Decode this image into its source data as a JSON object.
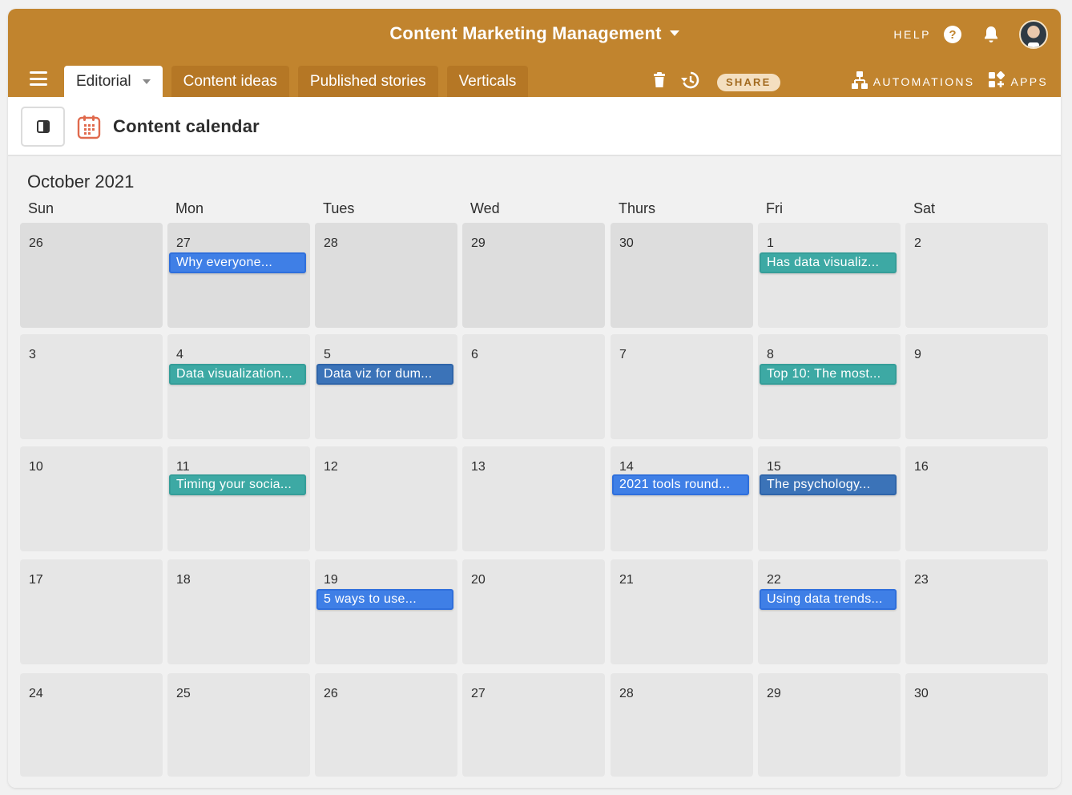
{
  "header": {
    "base_title": "Content Marketing Management",
    "help_label": "HELP",
    "help_glyph": "?",
    "icons": [
      "chevron-down-icon",
      "help-icon",
      "bell-icon",
      "avatar"
    ]
  },
  "tabs": [
    {
      "label": "Editorial",
      "active": true
    },
    {
      "label": "Content ideas",
      "active": false
    },
    {
      "label": "Published stories",
      "active": false
    },
    {
      "label": "Verticals",
      "active": false
    }
  ],
  "toolbar": {
    "share_label": "SHARE",
    "automations_label": "AUTOMATIONS",
    "apps_label": "APPS",
    "icons": [
      "trash-icon",
      "history-icon",
      "automations-icon",
      "apps-icon"
    ]
  },
  "view": {
    "title": "Content calendar",
    "icon": "calendar-icon"
  },
  "calendar": {
    "month_label": "October 2021",
    "weekdays": [
      "Sun",
      "Mon",
      "Tues",
      "Wed",
      "Thurs",
      "Fri",
      "Sat"
    ],
    "weeks": [
      [
        {
          "day": "26",
          "outside_month": true
        },
        {
          "day": "27",
          "outside_month": true,
          "event": {
            "title": "Why everyone...",
            "color": "blue"
          }
        },
        {
          "day": "28",
          "outside_month": true
        },
        {
          "day": "29",
          "outside_month": true
        },
        {
          "day": "30",
          "outside_month": true
        },
        {
          "day": "1",
          "event": {
            "title": "Has data visualiz...",
            "color": "teal"
          }
        },
        {
          "day": "2"
        }
      ],
      [
        {
          "day": "3"
        },
        {
          "day": "4",
          "event": {
            "title": "Data visualization...",
            "color": "teal"
          }
        },
        {
          "day": "5",
          "event": {
            "title": "Data viz for dum...",
            "color": "navy"
          }
        },
        {
          "day": "6"
        },
        {
          "day": "7"
        },
        {
          "day": "8",
          "event": {
            "title": "Top 10: The most...",
            "color": "teal"
          }
        },
        {
          "day": "9"
        }
      ],
      [
        {
          "day": "10"
        },
        {
          "day": "11",
          "event": {
            "title": "Timing your socia...",
            "color": "teal"
          }
        },
        {
          "day": "12"
        },
        {
          "day": "13"
        },
        {
          "day": "14",
          "event": {
            "title": "2021 tools round...",
            "color": "blue"
          }
        },
        {
          "day": "15",
          "event": {
            "title": "The psychology...",
            "color": "navy"
          }
        },
        {
          "day": "16"
        }
      ],
      [
        {
          "day": "17"
        },
        {
          "day": "18"
        },
        {
          "day": "19",
          "event": {
            "title": "5 ways to use...",
            "color": "blue"
          }
        },
        {
          "day": "20"
        },
        {
          "day": "21"
        },
        {
          "day": "22",
          "event": {
            "title": "Using data trends...",
            "color": "blue"
          }
        },
        {
          "day": "23"
        }
      ],
      [
        {
          "day": "24"
        },
        {
          "day": "25"
        },
        {
          "day": "26"
        },
        {
          "day": "27"
        },
        {
          "day": "28"
        },
        {
          "day": "29"
        },
        {
          "day": "30"
        }
      ]
    ]
  },
  "colors": {
    "topbar": "#c1842e",
    "event_blue": "#3f7fe6",
    "event_teal": "#3da9a4",
    "event_navy": "#3b73b8"
  }
}
